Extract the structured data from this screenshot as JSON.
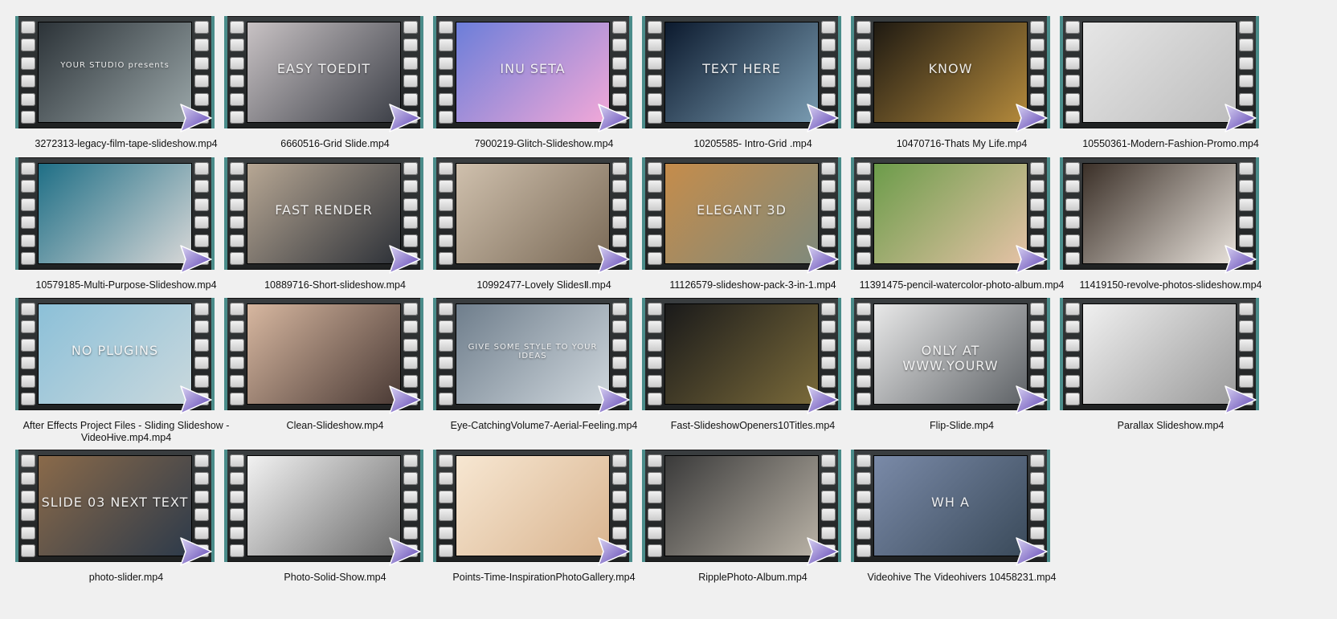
{
  "tiles": [
    {
      "label": "3272313-legacy-film-tape-slideshow.mp4",
      "caption": "YOUR STUDIO  presents",
      "bg": [
        "#2c3338",
        "#9aa6a8"
      ]
    },
    {
      "label": "6660516-Grid Slide.mp4",
      "caption": "EASY TOEDIT",
      "bg": [
        "#c8c2c4",
        "#3c3f47"
      ]
    },
    {
      "label": "7900219-Glitch-Slideshow.mp4",
      "caption": "INU  SETA",
      "bg": [
        "#6c7ed9",
        "#f2a8d8"
      ]
    },
    {
      "label": "10205585- Intro-Grid .mp4",
      "caption": "TEXT HERE",
      "bg": [
        "#0c1a2e",
        "#7a9cb2"
      ]
    },
    {
      "label": "10470716-Thats My Life.mp4",
      "caption": "KNOW",
      "bg": [
        "#1f1a12",
        "#b48a3c"
      ]
    },
    {
      "label": "10550361-Modern-Fashion-Promo.mp4",
      "caption": "",
      "bg": [
        "#e6e6e6",
        "#bdbdbd"
      ]
    },
    {
      "label": "10579185-Multi-Purpose-Slideshow.mp4",
      "caption": "",
      "bg": [
        "#1f6f86",
        "#d7d7d7"
      ]
    },
    {
      "label": "10889716-Short-slideshow.mp4",
      "caption": "FAST RENDER",
      "bg": [
        "#b7a794",
        "#2d3138"
      ]
    },
    {
      "label": "10992477-Lovely SlidesⅡ.mp4",
      "caption": "",
      "bg": [
        "#cfc0ad",
        "#7a6a57"
      ]
    },
    {
      "label": "11126579-slideshow-pack-3-in-1.mp4",
      "caption": "ELEGANT 3D",
      "bg": [
        "#c58c4b",
        "#7f8a7c"
      ]
    },
    {
      "label": "11391475-pencil-watercolor-photo-album.mp4",
      "caption": "",
      "bg": [
        "#6c9c4a",
        "#e5c2a6"
      ]
    },
    {
      "label": "11419150-revolve-photos-slideshow.mp4",
      "caption": "",
      "bg": [
        "#3b3028",
        "#e8e2db"
      ]
    },
    {
      "label": "After Effects Project Files - Sliding Slideshow - VideoHive.mp4.mp4",
      "caption": "NO PLUGINS",
      "bg": [
        "#8cc0d8",
        "#c9d8dd"
      ]
    },
    {
      "label": "Clean-Slideshow.mp4",
      "caption": "",
      "bg": [
        "#d7b7a0",
        "#4a3a35"
      ]
    },
    {
      "label": "Eye-CatchingVolume7-Aerial-Feeling.mp4",
      "caption": "GIVE SOME STYLE TO YOUR IDEAS",
      "bg": [
        "#6f7e8c",
        "#cfd7dd"
      ]
    },
    {
      "label": "Fast-SlideshowOpeners10Titles.mp4",
      "caption": "",
      "bg": [
        "#1a1a1a",
        "#7a6a3a"
      ]
    },
    {
      "label": "Flip-Slide.mp4",
      "caption": "ONLY AT WWW.YOURW",
      "bg": [
        "#e8e8e8",
        "#5e6266"
      ]
    },
    {
      "label": "Parallax Slideshow.mp4",
      "caption": "",
      "bg": [
        "#f0f0f0",
        "#9a9a9a"
      ]
    },
    {
      "label": "photo-slider.mp4",
      "caption": "SLIDE 03  NEXT TEXT",
      "bg": [
        "#8a6a4a",
        "#2d3a4a"
      ]
    },
    {
      "label": "Photo-Solid-Show.mp4",
      "caption": "",
      "bg": [
        "#f2f2f2",
        "#6a6a6a"
      ]
    },
    {
      "label": "Points-Time-InspirationPhotoGallery.mp4",
      "caption": "",
      "bg": [
        "#f7e7d2",
        "#d9b48f"
      ]
    },
    {
      "label": "RipplePhoto-Album.mp4",
      "caption": "",
      "bg": [
        "#3a3a3a",
        "#b9b2a6"
      ]
    },
    {
      "label": "Videohive The Videohivers 10458231.mp4",
      "caption": "WH      A",
      "bg": [
        "#7a8aa8",
        "#3a4a5a"
      ]
    }
  ],
  "colors": {
    "film_edge": "#4a8c8a",
    "play_light": "#d9d3f2",
    "play_dark": "#5a3eb2",
    "background": "#f0f0f0"
  },
  "icons": {
    "play": "play-triangle-icon"
  }
}
